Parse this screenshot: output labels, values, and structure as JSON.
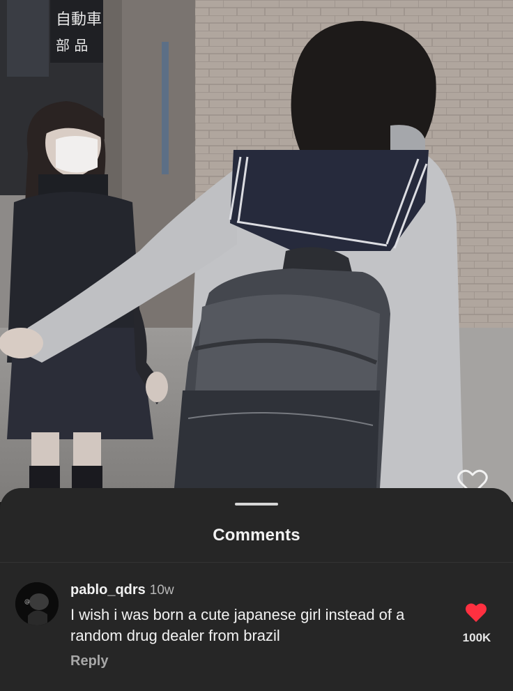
{
  "sheet": {
    "title": "Comments"
  },
  "comment": {
    "username": "pablo_qdrs",
    "time": "10w",
    "text": "I wish i was born a cute japanese girl instead of a random drug dealer from brazil",
    "reply_label": "Reply",
    "like_count": "100K",
    "liked": true
  },
  "photo": {
    "sign_text_1": "自動車",
    "sign_text_2": "部 品"
  },
  "colors": {
    "like": "#ff3040",
    "sheet_bg": "#262626"
  },
  "icons": {
    "photo_like": "heart-outline-icon",
    "comment_like": "heart-filled-icon"
  }
}
